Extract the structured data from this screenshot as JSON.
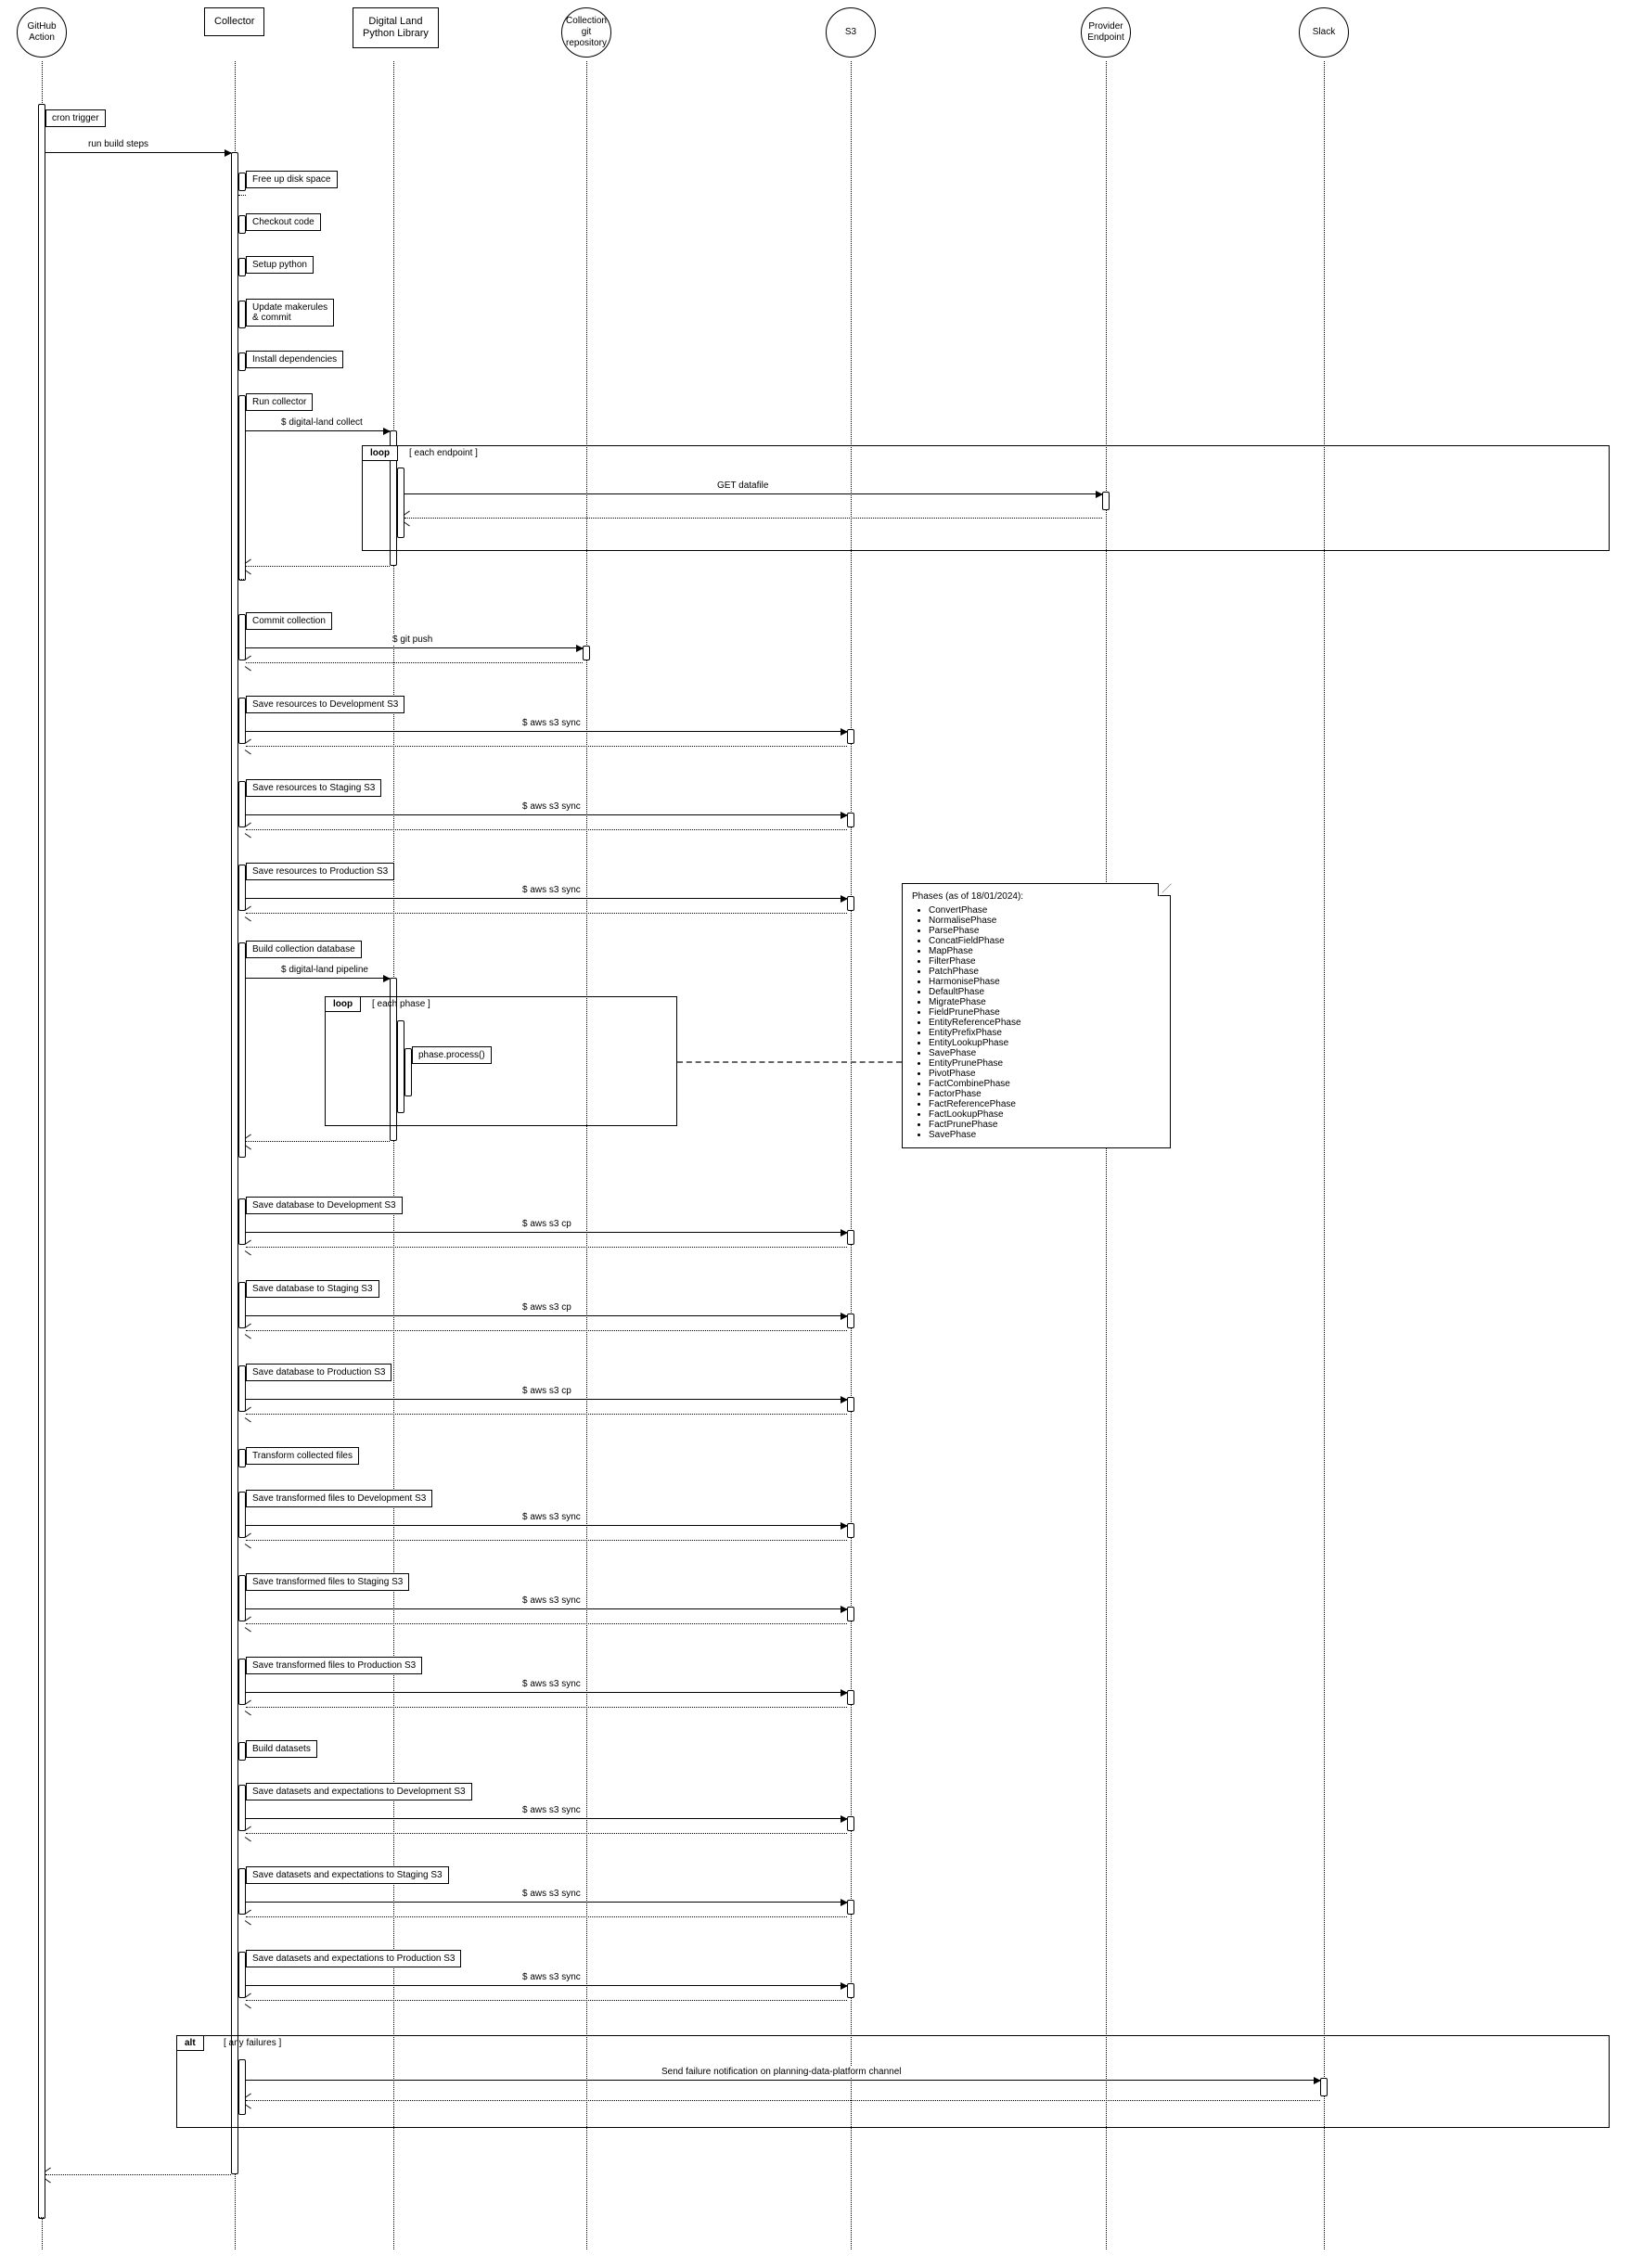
{
  "participants": {
    "github": "GitHub\nAction",
    "collector": "Collector",
    "dlpl": "Digital Land\nPython Library",
    "gitrepo": "Collection\ngit\nrepository",
    "s3": "S3",
    "provider": "Provider\nEndpoint",
    "slack": "Slack"
  },
  "messages": {
    "cron": "cron trigger",
    "runbuild": "run build steps",
    "freespace": "Free up disk space",
    "checkout": "Checkout code",
    "setuppy": "Setup python",
    "updatemake": "Update makerules\n& commit",
    "installdeps": "Install dependencies",
    "runcollector": "Run collector",
    "dlcollect": "$ digital-land collect",
    "eachendpoint": "[ each endpoint ]",
    "getdatafile": "GET datafile",
    "commitcoll": "Commit collection",
    "gitpush": "$ git push",
    "saveresdev": "Save resources to Development S3",
    "saveresstg": "Save resources to Staging S3",
    "saveresprod": "Save resources to Production S3",
    "awssync": "$ aws s3 sync",
    "buildcolldb": "Build collection database",
    "dlpipeline": "$ digital-land pipeline",
    "eachphase": "[ each phase ]",
    "phaseprocess": "phase.process()",
    "savedbdev": "Save database to Development S3",
    "savedbstg": "Save database to Staging S3",
    "savedbprod": "Save database to Production S3",
    "awscp": "$ aws s3 cp",
    "transform": "Transform collected files",
    "savetfdev": "Save transformed files to Development S3",
    "savetfstg": "Save transformed files to Staging S3",
    "savetfprod": "Save transformed files to Production S3",
    "builddatasets": "Build datasets",
    "savedsdev": "Save datasets and expectations to Development S3",
    "savedsstg": "Save datasets and expectations to Staging S3",
    "savedsprod": "Save datasets and expectations to Production S3",
    "anyfailures": "[ any failures ]",
    "sendfailure": "Send failure notification on planning-data-platform channel",
    "loop": "loop",
    "alt": "alt"
  },
  "note": {
    "title": "Phases (as of 18/01/2024):",
    "phases": [
      "ConvertPhase",
      "NormalisePhase",
      "ParsePhase",
      "ConcatFieldPhase",
      "MapPhase",
      "FilterPhase",
      "PatchPhase",
      "HarmonisePhase",
      "DefaultPhase",
      "MigratePhase",
      "FieldPrunePhase",
      "EntityReferencePhase",
      "EntityPrefixPhase",
      "EntityLookupPhase",
      "SavePhase",
      "EntityPrunePhase",
      "PivotPhase",
      "FactCombinePhase",
      "FactorPhase",
      "FactReferencePhase",
      "FactLookupPhase",
      "FactPrunePhase",
      "SavePhase"
    ]
  }
}
